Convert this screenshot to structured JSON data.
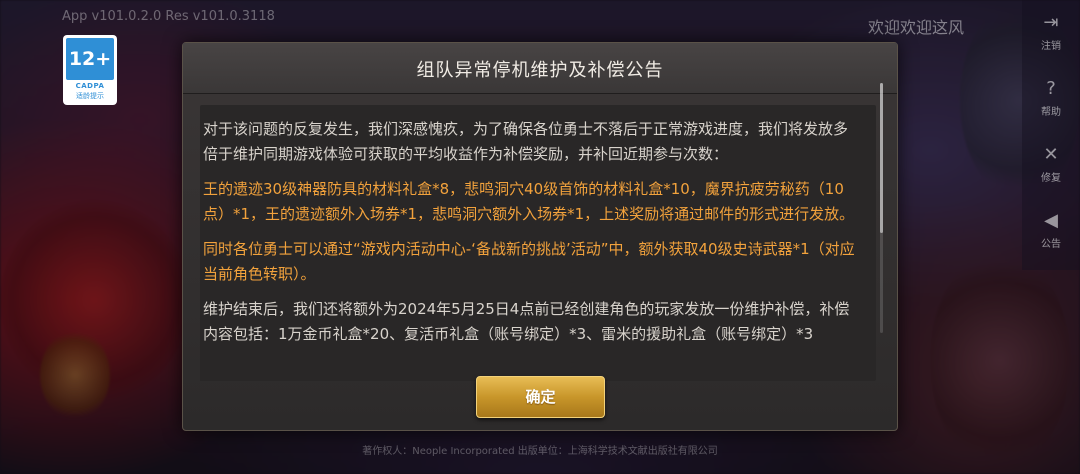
{
  "header": {
    "version": "App v101.0.2.0 Res v101.0.3118",
    "welcome": "欢迎欢迎这风"
  },
  "age_badge": {
    "rating": "12+",
    "org": "CADPA",
    "note": "适龄提示"
  },
  "side_menu": [
    {
      "icon": "logout-icon",
      "glyph": "⇥",
      "label": "注销"
    },
    {
      "icon": "help-icon",
      "glyph": "?",
      "label": "帮助"
    },
    {
      "icon": "repair-icon",
      "glyph": "✕",
      "label": "修复"
    },
    {
      "icon": "announcement-icon",
      "glyph": "◀",
      "label": "公告"
    }
  ],
  "modal": {
    "title": "组队异常停机维护及补偿公告",
    "paragraphs": [
      {
        "style": "normal",
        "text": "对于该问题的反复发生，我们深感愧疚，为了确保各位勇士不落后于正常游戏进度，我们将发放多倍于维护同期游戏体验可获取的平均收益作为补偿奖励，并补回近期参与次数："
      },
      {
        "style": "highlight",
        "text": "王的遗迹30级神器防具的材料礼盒*8，悲鸣洞穴40级首饰的材料礼盒*10，魔界抗疲劳秘药（10点）*1，王的遗迹额外入场券*1，悲鸣洞穴额外入场券*1，上述奖励将通过邮件的形式进行发放。"
      },
      {
        "style": "highlight",
        "text": "同时各位勇士可以通过“游戏内活动中心-‘备战新的挑战’活动”中，额外获取40级史诗武器*1（对应当前角色转职）。"
      },
      {
        "style": "normal",
        "text": "维护结束后，我们还将额外为2024年5月25日4点前已经创建角色的玩家发放一份维护补偿，补偿内容包括：1万金币礼盒*20、复活币礼盒（账号绑定）*3、雷米的援助礼盒（账号绑定）*3"
      }
    ],
    "confirm_label": "确定"
  },
  "footer": {
    "copyright": "著作权人：Neople Incorporated 出版单位：上海科学技术文献出版社有限公司"
  },
  "colors": {
    "highlight_text": "#f2a23c",
    "normal_text": "#d8d3cc",
    "button_gold": "#c8962a",
    "age_badge_blue": "#2f8fd6"
  }
}
